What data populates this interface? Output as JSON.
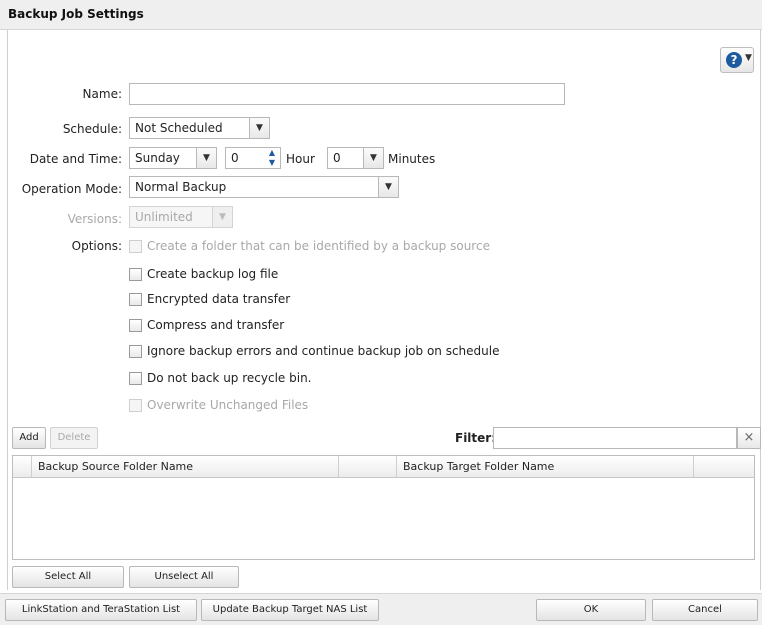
{
  "title": "Backup Job Settings",
  "form": {
    "name_label": "Name:",
    "name_value": "",
    "schedule_label": "Schedule:",
    "schedule_value": "Not Scheduled",
    "datetime_label": "Date and Time:",
    "day_value": "Sunday",
    "hour_value": "0",
    "hour_label": "Hour",
    "minute_value": "0",
    "minutes_label": "Minutes",
    "mode_label": "Operation Mode:",
    "mode_value": "Normal Backup",
    "versions_label": "Versions:",
    "versions_value": "Unlimited",
    "options_label": "Options:"
  },
  "options": [
    {
      "label": "Create a folder that can be identified by a backup source",
      "checked": false,
      "enabled": false
    },
    {
      "label": "Create backup log file",
      "checked": false,
      "enabled": true
    },
    {
      "label": "Encrypted data transfer",
      "checked": false,
      "enabled": true
    },
    {
      "label": "Compress and transfer",
      "checked": false,
      "enabled": true
    },
    {
      "label": "Ignore backup errors and continue backup job on schedule",
      "checked": false,
      "enabled": true
    },
    {
      "label": "Do not back up recycle bin.",
      "checked": false,
      "enabled": true
    },
    {
      "label": "Overwrite Unchanged Files",
      "checked": false,
      "enabled": false
    }
  ],
  "toolbar": {
    "add_label": "Add",
    "delete_label": "Delete",
    "filter_label": "Filter:",
    "filter_value": "",
    "clear_glyph": "×"
  },
  "table": {
    "columns": [
      "Backup Source Folder Name",
      "Backup Target Folder Name"
    ],
    "rows": []
  },
  "selection": {
    "select_all": "Select All",
    "unselect_all": "Unselect All"
  },
  "footer": {
    "station_list": "LinkStation and TeraStation List",
    "update_list": "Update Backup Target NAS List",
    "ok": "OK",
    "cancel": "Cancel"
  },
  "icons": {
    "help": "help-icon",
    "dropdown": "chevron-down-icon",
    "spinner": "spinner-arrows-icon",
    "clear": "close-icon"
  },
  "colors": {
    "help_icon": "#1e5a9e",
    "disabled_text": "#a8a8a8"
  }
}
